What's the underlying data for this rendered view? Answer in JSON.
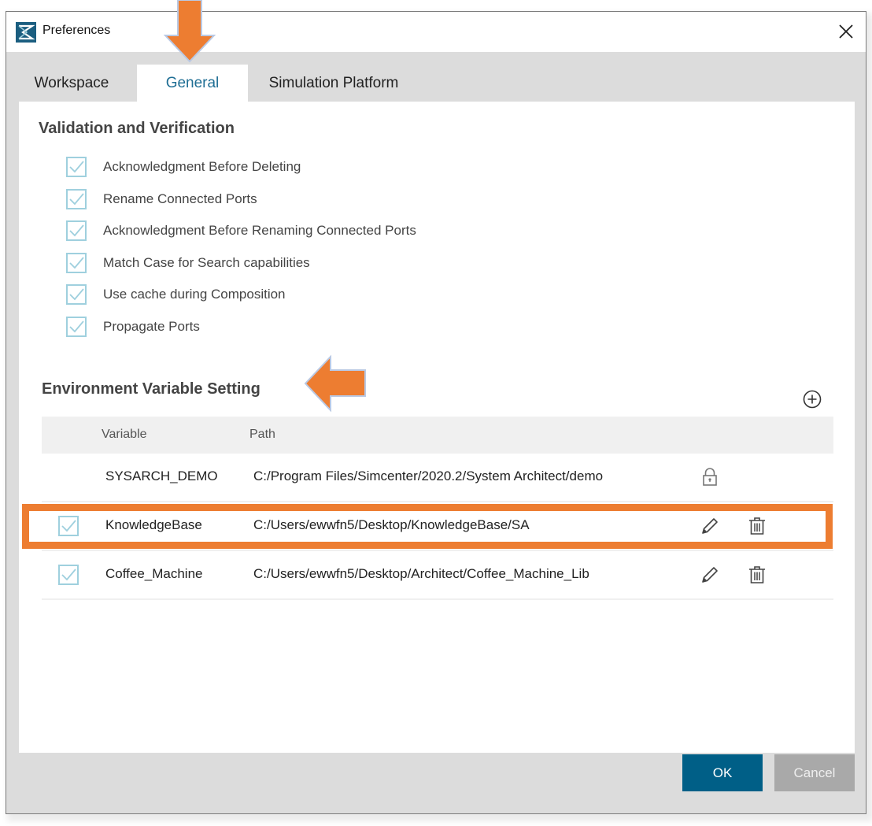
{
  "window": {
    "title": "Preferences",
    "app_icon": "simcenter-logo-icon",
    "close_icon": "close-icon"
  },
  "tabs": [
    {
      "label": "Workspace",
      "active": false
    },
    {
      "label": "General",
      "active": true
    },
    {
      "label": "Simulation Platform",
      "active": false
    }
  ],
  "validation": {
    "title": "Validation and Verification",
    "options": [
      {
        "label": "Acknowledgment Before Deleting",
        "checked": true
      },
      {
        "label": "Rename Connected Ports",
        "checked": true
      },
      {
        "label": "Acknowledgment Before Renaming Connected Ports",
        "checked": true
      },
      {
        "label": "Match Case for Search capabilities",
        "checked": true
      },
      {
        "label": "Use cache during Composition",
        "checked": true
      },
      {
        "label": "Propagate Ports",
        "checked": true
      }
    ]
  },
  "environment": {
    "title": "Environment Variable Setting",
    "add_icon": "add-circle-icon",
    "columns": [
      "Variable",
      "Path"
    ],
    "rows": [
      {
        "checked": null,
        "variable": "SYSARCH_DEMO",
        "path": "C:/Program Files/Simcenter/2020.2/System Architect/demo",
        "actions": [
          "lock-icon"
        ],
        "highlighted": false
      },
      {
        "checked": true,
        "variable": "KnowledgeBase",
        "path": "C:/Users/ewwfn5/Desktop/KnowledgeBase/SA",
        "actions": [
          "pencil-icon",
          "trash-icon"
        ],
        "highlighted": true
      },
      {
        "checked": true,
        "variable": "Coffee_Machine",
        "path": "C:/Users/ewwfn5/Desktop/Architect/Coffee_Machine_Lib",
        "actions": [
          "pencil-icon",
          "trash-icon"
        ],
        "highlighted": false
      }
    ]
  },
  "buttons": {
    "ok": "OK",
    "cancel": "Cancel"
  },
  "colors": {
    "accent": "#005f87",
    "active_tab_text": "#1f6e94",
    "checkbox": "#9fd0de",
    "annotation": "#ed7d31",
    "disabled_button": "#a9a9a9"
  },
  "annotations": [
    {
      "type": "arrow-down",
      "target": "General tab"
    },
    {
      "type": "arrow-left",
      "target": "Environment Variable Setting"
    },
    {
      "type": "highlight-box",
      "target": "KnowledgeBase row"
    }
  ]
}
